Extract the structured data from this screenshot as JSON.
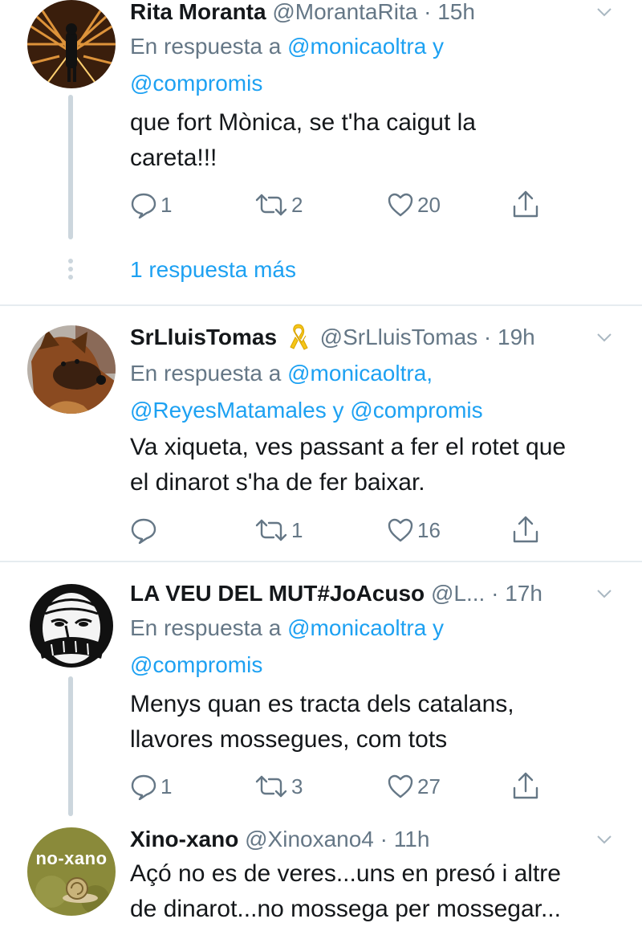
{
  "tweets": [
    {
      "name": "Rita Moranta",
      "handle": "@MorantaRita",
      "dot": "·",
      "time": "15h",
      "reply_prefix": "En respuesta a",
      "mentions_line1": "@monicaoltra y",
      "mentions_line2": "@compromis",
      "text_line1": "que fort Mònica, se t'ha caigut la",
      "text_line2": "careta!!!",
      "replies": "1",
      "retweets": "2",
      "likes": "20",
      "more_replies": "1 respuesta más",
      "avatar_icon": "person-on-bridge-photo"
    },
    {
      "name": "SrLluisTomas",
      "name_emoji": "yellow-ribbon-icon",
      "handle": "@SrLluisTomas",
      "dot": "·",
      "time": "19h",
      "reply_prefix": "En respuesta a",
      "mentions_line1": "@monicaoltra,",
      "mentions_line2a": "@ReyesMatamales",
      "mentions_join": "y",
      "mentions_line2b": "@compromis",
      "text_line1": "Va xiqueta, ves passant a fer el rotet que",
      "text_line2": "el dinarot s'ha de fer baixar.",
      "replies": "",
      "retweets": "1",
      "likes": "16",
      "avatar_icon": "dog-photo"
    },
    {
      "name": "LA VEU DEL MUT#JoAcuso",
      "handle": "@L...",
      "dot": "·",
      "time": "17h",
      "reply_prefix": "En respuesta a",
      "mentions_line1": "@monicaoltra y",
      "mentions_line2": "@compromis",
      "text_line1": "Menys quan es tracta dels catalans,",
      "text_line2": "llavores mossegues, com tots",
      "replies": "1",
      "retweets": "3",
      "likes": "27",
      "avatar_icon": "masked-face-drawing"
    },
    {
      "name": "Xino-xano",
      "handle": "@Xinoxano4",
      "dot": "·",
      "time": "11h",
      "text_line1": "Açó no es de veres...uns en presó i altre",
      "text_line2": "de dinarot...no mossega per mossegar...",
      "avatar_text": "no-xano",
      "avatar_icon": "snail-logo"
    }
  ],
  "colors": {
    "link": "#1da1f2",
    "muted": "#657786",
    "text": "#14171a",
    "divider": "#e6ecf0",
    "thread": "#ccd6dd"
  }
}
